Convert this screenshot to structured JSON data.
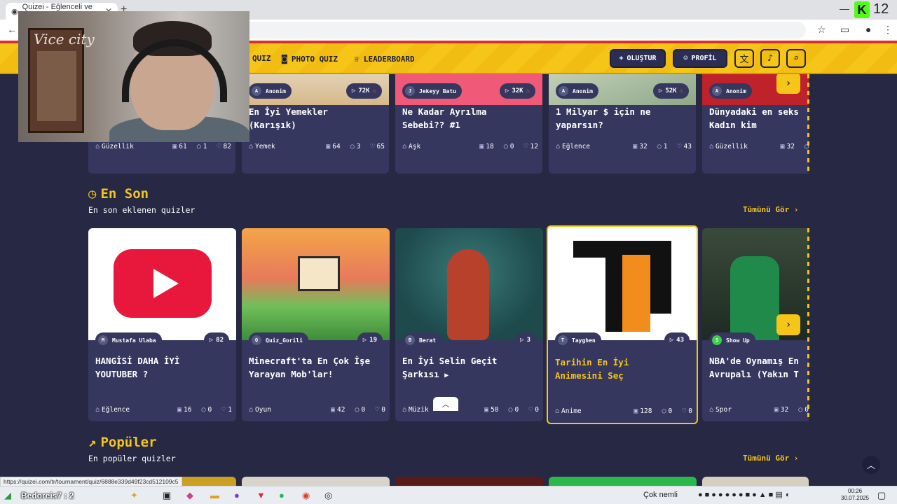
{
  "browser": {
    "tab_title": "Quizei - Eğlenceli ve etkileşimli",
    "new_tab": "+",
    "win_min": "—",
    "win_close": "✕",
    "ext_count": "12",
    "ext_letter": "K",
    "url_status": "https://quizei.com/tr/tournament/quiz/6888e339d49f23cd512109c5"
  },
  "nav": {
    "quiz": "QUIZ",
    "photo_quiz": "PHOTO QUIZ",
    "leaderboard": "LEADERBOARD",
    "create": "OLUŞTUR",
    "profile": "PROFİL"
  },
  "webcam": {
    "script_text": "Vice city"
  },
  "sections": {
    "latest_title": "En Son",
    "latest_sub": "En son eklenen quizler",
    "popular_title": "Popüler",
    "popular_sub": "En popüler quizler",
    "see_all": "Tümünü Gör ›"
  },
  "top_cards": [
    {
      "author": "Anonim",
      "plays": "",
      "hot": false,
      "title": "",
      "category": "Güzellik",
      "questions": "61",
      "comments": "1",
      "likes": "82"
    },
    {
      "author": "Anonim",
      "plays": "72K",
      "hot": true,
      "title": "En İyi Yemekler\n(Karışık)",
      "category": "Yemek",
      "questions": "64",
      "comments": "3",
      "likes": "65"
    },
    {
      "author": "Jekeyy Batu",
      "plays": "32K",
      "hot": true,
      "title": "Ne Kadar Ayrılma\nSebebi?? #1",
      "category": "Aşk",
      "questions": "18",
      "comments": "0",
      "likes": "12"
    },
    {
      "author": "Anonim",
      "plays": "52K",
      "hot": true,
      "title": "1 Milyar $ için ne\nyaparsın?",
      "category": "Eğlence",
      "questions": "32",
      "comments": "1",
      "likes": "43"
    },
    {
      "author": "Anonim",
      "plays": "",
      "hot": false,
      "title": "Dünyadaki en seks\nKadın kim",
      "category": "Güzellik",
      "questions": "32",
      "comments": "",
      "likes": ""
    }
  ],
  "latest_cards": [
    {
      "author": "Mustafa Ulaba",
      "plays": "82",
      "title": "HANGİSİ DAHA İYİ\nYOUTUBER ?",
      "category": "Eğlence",
      "questions": "16",
      "comments": "0",
      "likes": "1"
    },
    {
      "author": "Quiz_Gorili",
      "plays": "19",
      "title": "Minecraft'ta En Çok İşe\nYarayan Mob'lar!",
      "category": "Oyun",
      "questions": "42",
      "comments": "0",
      "likes": "0"
    },
    {
      "author": "Berat",
      "plays": "3",
      "title": "En İyi Selin Geçit\nŞarkısı",
      "category": "Müzik",
      "questions": "50",
      "comments": "0",
      "likes": "0"
    },
    {
      "author": "Tayghen",
      "plays": "43",
      "title": "Tarihin En İyi\nAnimesini Seç",
      "category": "Anime",
      "questions": "128",
      "comments": "0",
      "likes": "0"
    },
    {
      "author": "Show Up",
      "plays": "",
      "title": "NBA'de Oynamış En\nAvrupalı (Yakın T",
      "category": "Spor",
      "questions": "32",
      "comments": "0",
      "likes": ""
    }
  ],
  "taskbar": {
    "user": "Bedoreis7 : 2",
    "weather": "Çok nemli",
    "time": "00:26",
    "date": "30.07.2025"
  },
  "colors": {
    "accent": "#f5c518",
    "card": "#35375e",
    "bg": "#262844",
    "youtube": "#e8173c"
  }
}
